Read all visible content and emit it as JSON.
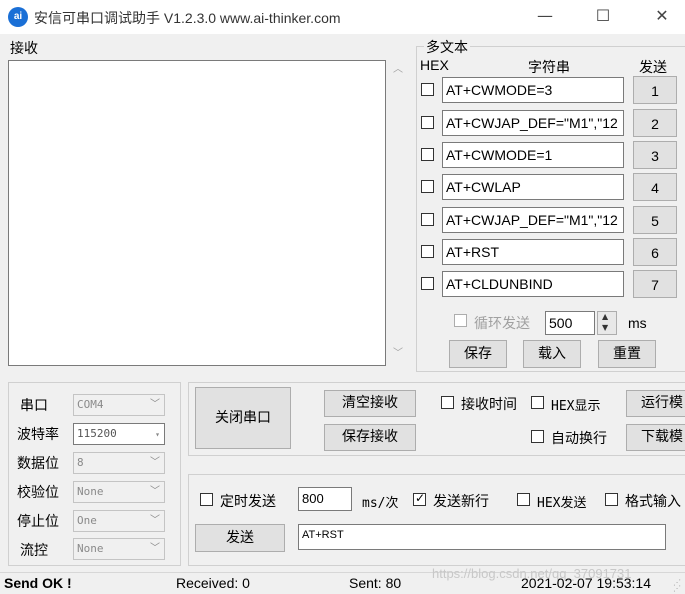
{
  "window": {
    "icon_text": "ai",
    "title": "安信可串口调试助手 V1.2.3.0    www.ai-thinker.com",
    "minimize_glyph": "—",
    "maximize_glyph": "☐",
    "close_glyph": "✕"
  },
  "receive": {
    "label": "接收",
    "content": ""
  },
  "multi_text": {
    "title": "多文本",
    "col_hex": "HEX",
    "col_string": "字符串",
    "col_send": "发送",
    "rows": [
      {
        "text": "AT+CWMODE=3",
        "button": "1",
        "hex_checked": false
      },
      {
        "text": "AT+CWJAP_DEF=\"M1\",\"12",
        "button": "2",
        "hex_checked": false
      },
      {
        "text": "AT+CWMODE=1",
        "button": "3",
        "hex_checked": false
      },
      {
        "text": "AT+CWLAP",
        "button": "4",
        "hex_checked": false
      },
      {
        "text": "AT+CWJAP_DEF=\"M1\",\"12",
        "button": "5",
        "hex_checked": false
      },
      {
        "text": "AT+RST",
        "button": "6",
        "hex_checked": false
      },
      {
        "text": "AT+CLDUNBIND",
        "button": "7",
        "hex_checked": false
      }
    ],
    "loop_send_label": "循环发送",
    "loop_interval": "500",
    "loop_unit": "ms",
    "save_btn": "保存",
    "load_btn": "载入",
    "reset_btn": "重置"
  },
  "serial": {
    "port_label": "串口",
    "port_value": "COM4",
    "baud_label": "波特率",
    "baud_value": "115200",
    "databits_label": "数据位",
    "databits_value": "8",
    "parity_label": "校验位",
    "parity_value": "None",
    "stopbits_label": "停止位",
    "stopbits_value": "One",
    "flow_label": "流控",
    "flow_value": "None"
  },
  "controls": {
    "close_port_btn": "关闭串口",
    "clear_recv_btn": "清空接收",
    "save_recv_btn": "保存接收",
    "recv_time_label": "接收时间",
    "hex_display_label": "HEX显示",
    "auto_wrap_label": "自动换行",
    "run_mode_btn": "运行模",
    "download_mode_btn": "下载模"
  },
  "send": {
    "timed_send_label": "定时发送",
    "interval_value": "800",
    "interval_unit": "ms/次",
    "send_newline_label": "发送新行",
    "send_newline_checked": true,
    "hex_send_label": "HEX发送",
    "format_input_label": "格式输入",
    "send_btn": "发送",
    "send_text": "AT+RST"
  },
  "status": {
    "message": "Send OK !",
    "received": "Received: 0",
    "sent": "Sent: 80",
    "datetime": "2021-02-07 19:53:14",
    "watermark": "https://blog.csdn.net/qq_37091731"
  }
}
